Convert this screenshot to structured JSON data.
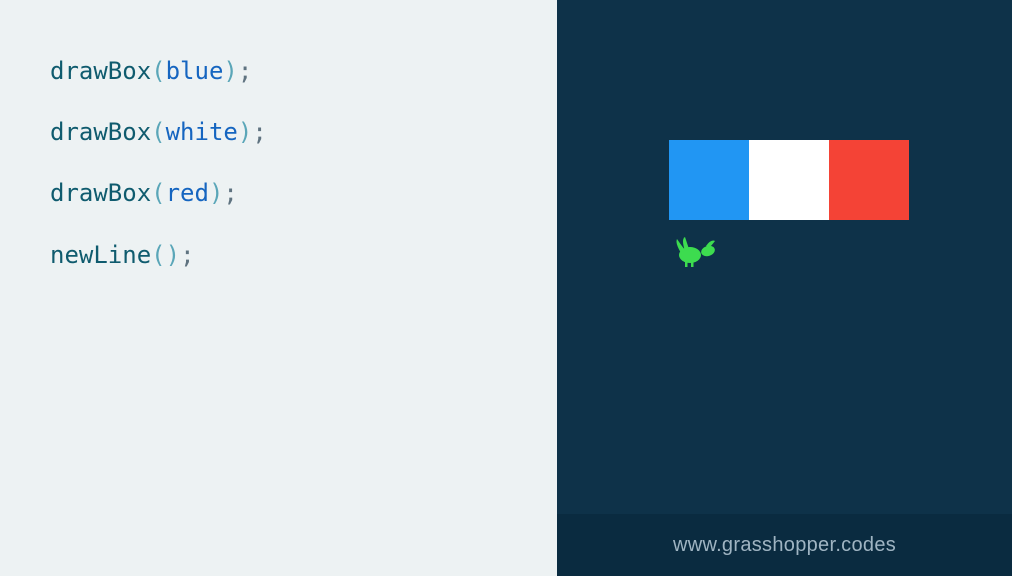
{
  "code": {
    "lines": [
      {
        "fn": "drawBox",
        "arg": "blue"
      },
      {
        "fn": "drawBox",
        "arg": "white"
      },
      {
        "fn": "drawBox",
        "arg": "red"
      },
      {
        "fn": "newLine",
        "arg": ""
      }
    ]
  },
  "punct": {
    "open": "(",
    "close": ")",
    "semi": ";"
  },
  "output": {
    "boxes": [
      {
        "color_name": "blue",
        "hex": "#2196f3"
      },
      {
        "color_name": "white",
        "hex": "#ffffff"
      },
      {
        "color_name": "red",
        "hex": "#f44336"
      }
    ]
  },
  "icons": {
    "grasshopper_color": "#3ddc4f"
  },
  "footer": {
    "url": "www.grasshopper.codes"
  }
}
